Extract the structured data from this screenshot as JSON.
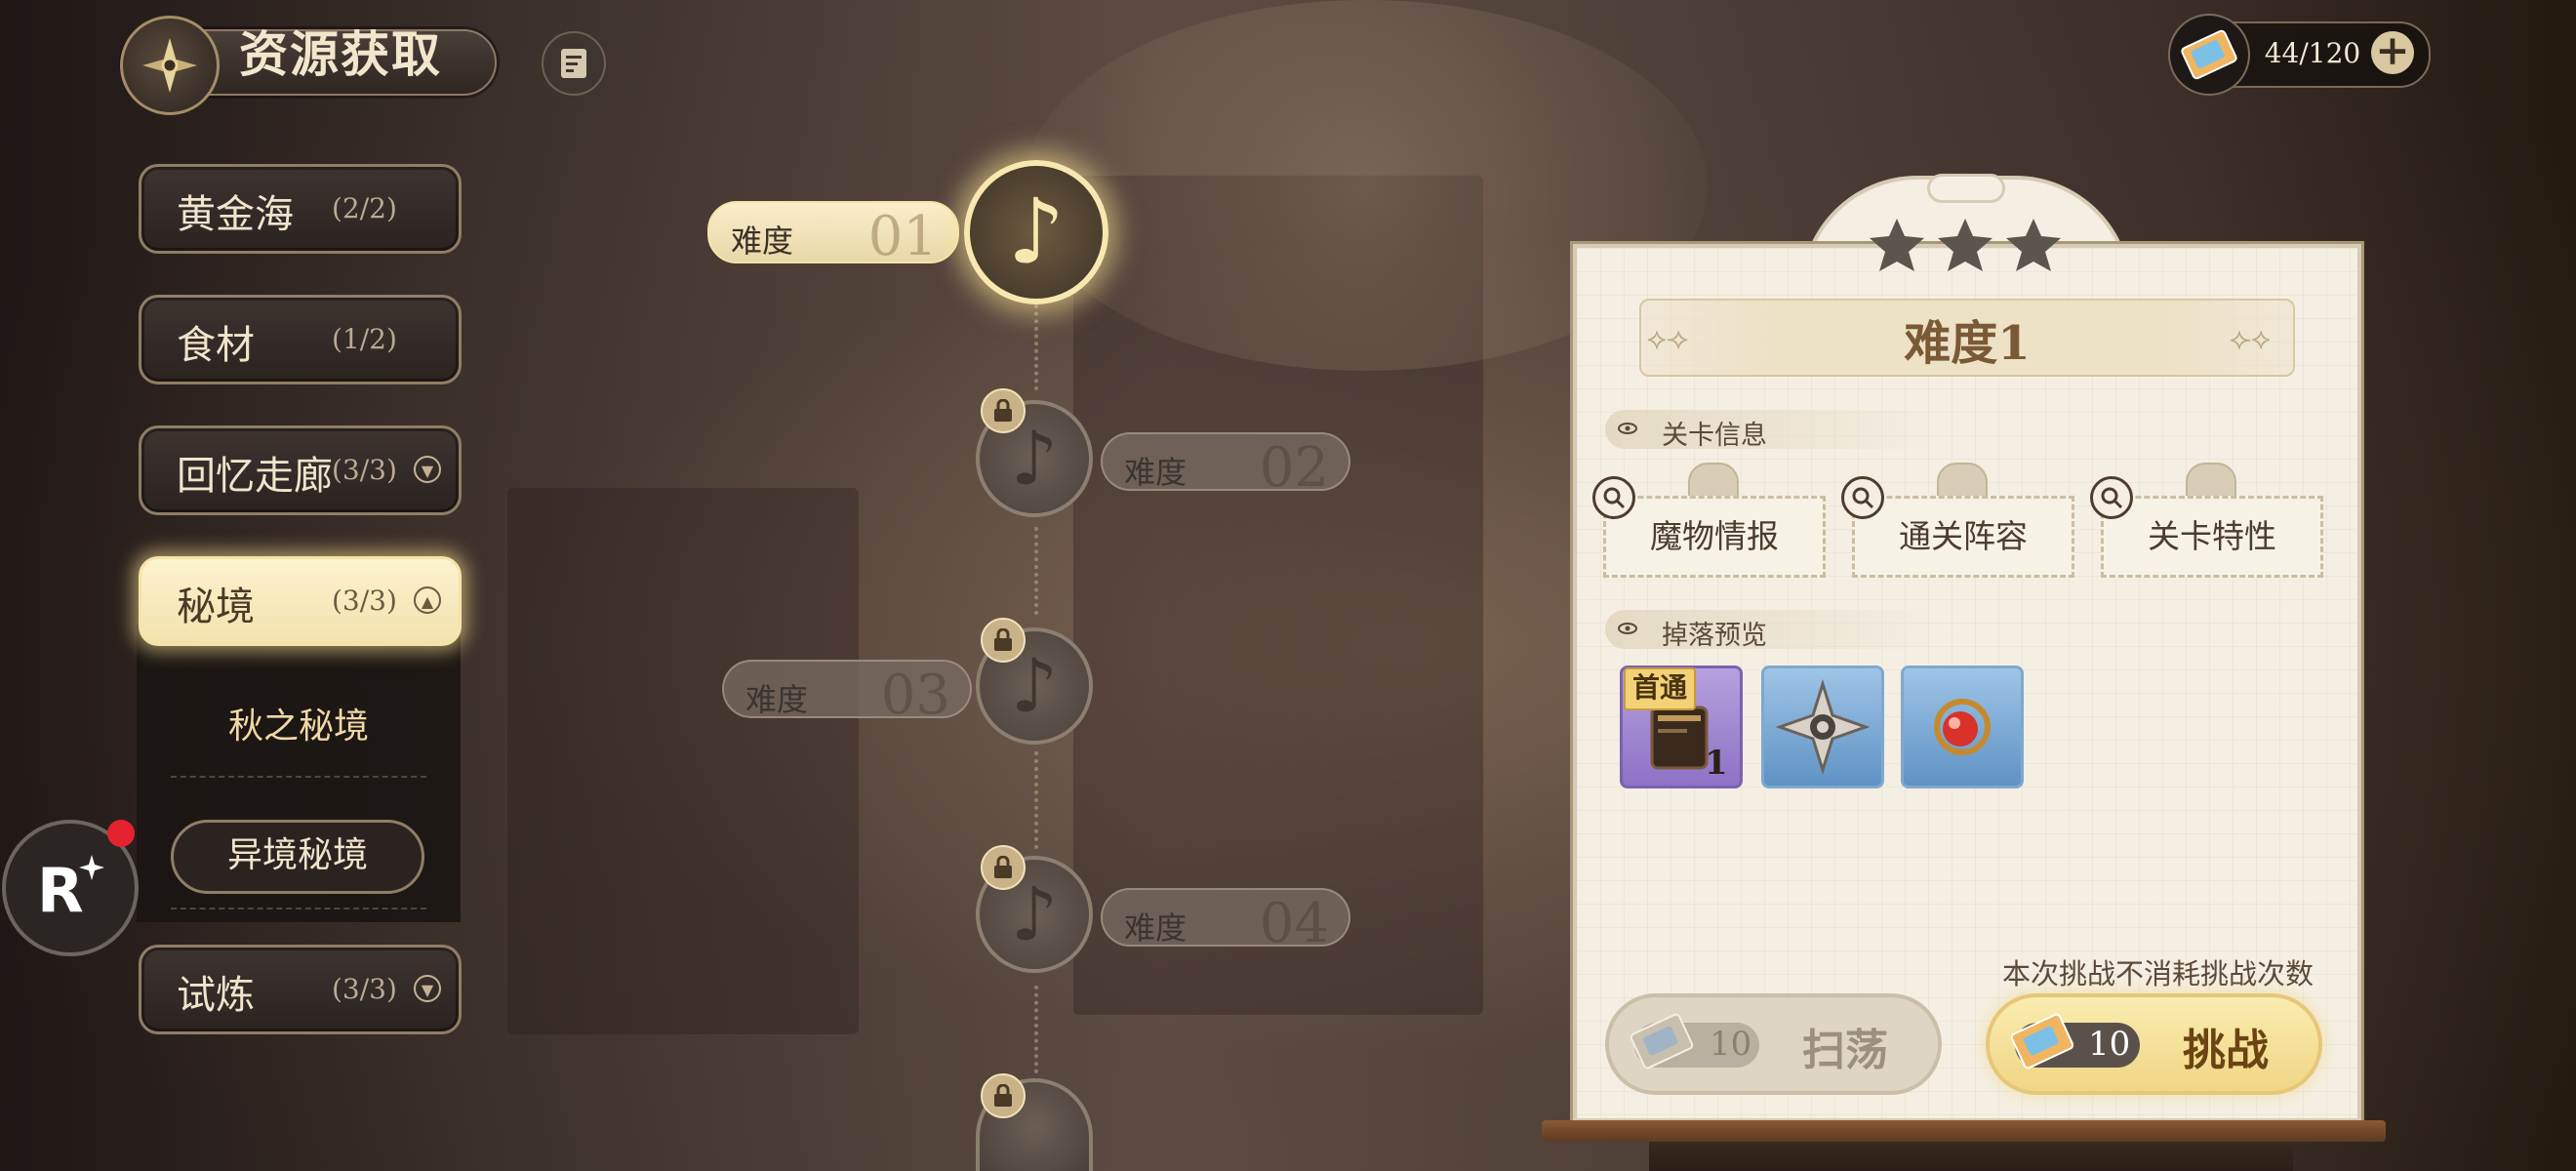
{
  "header": {
    "title": "资源获取"
  },
  "stamina": {
    "value": "44/120",
    "plus_label": "+"
  },
  "menu": {
    "items": [
      {
        "label": "黄金海",
        "count": "(2/2)"
      },
      {
        "label": "食材",
        "count": "(1/2)"
      },
      {
        "label": "回忆走廊",
        "count": "(3/3)"
      },
      {
        "label": "秘境",
        "count": "(3/3)"
      },
      {
        "label": "试炼",
        "count": "(3/3)"
      }
    ],
    "submenu": [
      {
        "label": "秋之秘境"
      },
      {
        "label": "异境秘境"
      }
    ]
  },
  "difficulty_path": {
    "nodes": [
      {
        "label": "难度",
        "number": "01",
        "locked": false,
        "selected": true
      },
      {
        "label": "难度",
        "number": "02",
        "locked": true
      },
      {
        "label": "难度",
        "number": "03",
        "locked": true
      },
      {
        "label": "难度",
        "number": "04",
        "locked": true
      }
    ]
  },
  "stage_panel": {
    "title": "难度1",
    "stars_filled": 0,
    "stars_total": 3,
    "info_section": "关卡信息",
    "info_cards": [
      "魔物情报",
      "通关阵容",
      "关卡特性"
    ],
    "drops_section": "掉落预览",
    "drops": [
      {
        "badge": "首通",
        "quantity": "1",
        "rarity": "purple"
      },
      {
        "rarity": "blue"
      },
      {
        "rarity": "blue"
      }
    ],
    "note": "本次挑战不消耗挑战次数",
    "sweep": {
      "cost": "10",
      "label": "扫荡"
    },
    "challenge": {
      "cost": "10",
      "label": "挑战"
    }
  },
  "colors": {
    "accent_gold": "#f6e3a6",
    "notification_red": "#e5222e",
    "title_brown": "#7a5a36"
  }
}
